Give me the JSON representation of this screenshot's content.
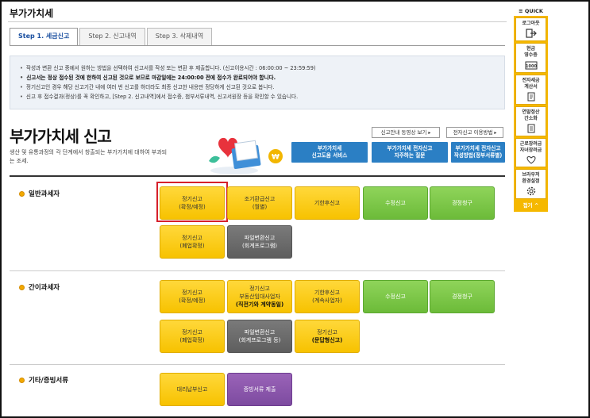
{
  "page_title": "부가가치세",
  "tabs": [
    {
      "label": "Step 1. 세금신고",
      "active": true
    },
    {
      "label": "Step 2. 신고내역",
      "active": false
    },
    {
      "label": "Step 3. 삭제내역",
      "active": false
    }
  ],
  "notices": [
    "작성과 변환 신고 중에서 원하는 방법을 선택하여 신고서를 작성 또는 변환 후 제출합니다. (신고이용시간 : 06:00:00 ~ 23:59:59)",
    "신고서는 정상 접수된 것에 한하여 신고된 것으로 보므로 마감일에는 24:00:00 전에 접수가 완료되어야 합니다.",
    "정기신고인 경우 해당 신고기간 내에 여러 번 신고를 하더라도 최종 신고한 내용만 정당하게 신고된 것으로 봅니다.",
    "신고 후 접수결과(정상)를 꼭 확인하고, [Step 2. 신고내역]에서 접수증, 첨부서류내역, 신고서원장 등을 확인할 수 있습니다."
  ],
  "main": {
    "title": "부가가치세 신고",
    "description": "생산 및 유통과정의 각 단계에서 창출되는 부가가치에 대하여 부과되는 조세."
  },
  "links": {
    "video": "신고안내 동영상 보기",
    "e_filing": "전자신고 이용방법"
  },
  "blue_buttons": [
    {
      "line1": "부가가치세",
      "line2": "신고도움 서비스"
    },
    {
      "line1": "부가가치세 전자신고",
      "line2": "자주하는 질문"
    },
    {
      "line1": "부가가치세 전자신고",
      "line2": "작성방법(정부서류별)"
    }
  ],
  "sections": {
    "general": {
      "label": "일반과세자",
      "buttons": [
        {
          "line1": "정기신고",
          "line2": "(확정/예정)"
        },
        {
          "line1": "조기환급신고",
          "line2": "(월별)"
        },
        {
          "line1": "기한후신고",
          "line2": ""
        },
        {
          "line1": "수정신고",
          "line2": ""
        },
        {
          "line1": "경정청구",
          "line2": ""
        },
        {
          "line1": "정기신고",
          "line2": "(폐업확정)"
        },
        {
          "line1": "파일변환신고",
          "line2": "(회계프로그램)"
        }
      ]
    },
    "simple": {
      "label": "간이과세자",
      "buttons": [
        {
          "line1": "정기신고",
          "line2": "(확정/예정)"
        },
        {
          "line1": "정기신고",
          "line2": "부동산임대사업자",
          "line3": "(직전기와 계약동일)"
        },
        {
          "line1": "기한후신고",
          "line2": "(계속사업자)"
        },
        {
          "line1": "수정신고",
          "line2": ""
        },
        {
          "line1": "경정청구",
          "line2": ""
        },
        {
          "line1": "정기신고",
          "line2": "(폐업확정)"
        },
        {
          "line1": "파일변환신고",
          "line2": "(회계프로그램 등)"
        },
        {
          "line1": "정기신고",
          "line2": "(문답형신고)"
        }
      ]
    },
    "other": {
      "label": "기타/증빙서류",
      "buttons": [
        {
          "line1": "대리납부신고",
          "line2": ""
        },
        {
          "line1": "증빙서류 제출",
          "line2": ""
        }
      ]
    }
  },
  "quick": {
    "header": "≡ QUICK",
    "items": [
      {
        "label": "로그아웃",
        "icon": "logout-icon"
      },
      {
        "label": "현금\n영수증",
        "icon": "receipt-icon"
      },
      {
        "label": "전자세금\n계산서",
        "icon": "invoice-icon"
      },
      {
        "label": "연말정산\n간소화",
        "icon": "document-icon"
      },
      {
        "label": "근로장려금\n자녀장려금",
        "icon": "heart-icon"
      },
      {
        "label": "브라우저\n환경설정",
        "icon": "gear-icon"
      }
    ],
    "close": "접기 ^"
  },
  "colors": {
    "accent_blue": "#2b7fc4",
    "yellow": "#f7c200",
    "green": "#6cbb39",
    "gray": "#5e5e5e",
    "purple": "#7d4ba0",
    "highlight_red": "#d6202b",
    "quick_panel": "#f5b800"
  }
}
